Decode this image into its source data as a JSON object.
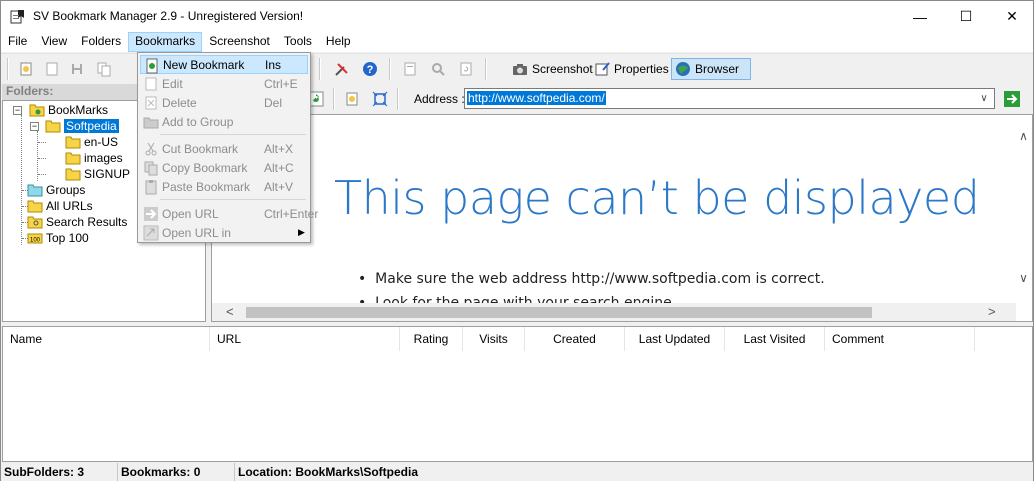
{
  "window": {
    "title": "SV Bookmark Manager 2.9 - Unregistered Version!",
    "min_glyph": "—",
    "max_glyph": "☐",
    "close_glyph": "✕"
  },
  "menubar": {
    "items": [
      "File",
      "View",
      "Folders",
      "Bookmarks",
      "Screenshot",
      "Tools",
      "Help"
    ],
    "active": "Bookmarks"
  },
  "toolbar": {
    "screenshot_label": "Screenshot",
    "properties_label": "Properties",
    "browser_label": "Browser",
    "browser_pressed": true
  },
  "folders": {
    "header": "Folders:",
    "tree": {
      "root": "BookMarks",
      "selected": "Softpedia",
      "children": [
        "en-US",
        "images",
        "SIGNUP"
      ],
      "others": [
        "Groups",
        "All URLs",
        "Search Results",
        "Top 100"
      ]
    }
  },
  "address": {
    "label": "Address :",
    "value": "http://www.softpedia.com/"
  },
  "browser": {
    "heading": "This page can’t be displayed",
    "bullet1": "Make sure the web address http://www.softpedia.com is correct.",
    "bullet2": "Look for the page with your search engine."
  },
  "list": {
    "columns": [
      "Name",
      "URL",
      "Rating",
      "Visits",
      "Created",
      "Last Updated",
      "Last Visited",
      "Comment"
    ]
  },
  "status": {
    "subfolders": "SubFolders: 3",
    "bookmarks": "Bookmarks: 0",
    "location": "Location: BookMarks\\Softpedia"
  },
  "bookmarks_menu": {
    "items": [
      {
        "label": "New Bookmark",
        "key": "Ins",
        "enabled": true,
        "highlighted": true
      },
      {
        "label": "Edit",
        "key": "Ctrl+E",
        "enabled": false
      },
      {
        "label": "Delete",
        "key": "Del",
        "enabled": false
      },
      {
        "label": "Add to Group",
        "key": "",
        "enabled": false
      },
      {
        "label": "Cut Bookmark",
        "key": "Alt+X",
        "enabled": false
      },
      {
        "label": "Copy Bookmark",
        "key": "Alt+C",
        "enabled": false
      },
      {
        "label": "Paste Bookmark",
        "key": "Alt+V",
        "enabled": false
      },
      {
        "label": "Open URL",
        "key": "Ctrl+Enter",
        "enabled": false
      },
      {
        "label": "Open URL in",
        "key": "",
        "enabled": false,
        "submenu": true
      }
    ]
  },
  "colors": {
    "selection": "#0078d7",
    "menu_highlight": "#cce8ff",
    "error_heading": "#2b78c9"
  }
}
